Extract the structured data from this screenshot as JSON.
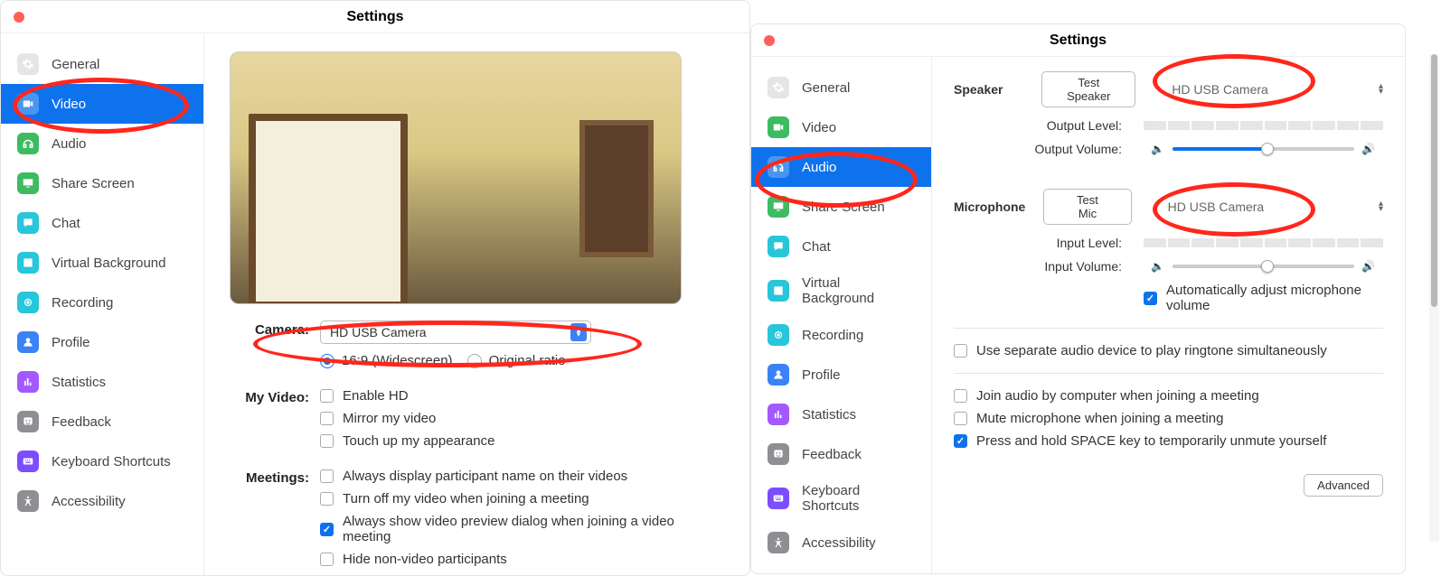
{
  "annotation_color": "#ff261b",
  "left": {
    "title": "Settings",
    "sidebar": [
      {
        "label": "General",
        "name": "general",
        "iconBg": "#e5e5e5"
      },
      {
        "label": "Video",
        "name": "video",
        "iconBg": "#0e72ed",
        "selected": true
      },
      {
        "label": "Audio",
        "name": "audio",
        "iconBg": "#3dbb61"
      },
      {
        "label": "Share Screen",
        "name": "share-screen",
        "iconBg": "#3dbb61"
      },
      {
        "label": "Chat",
        "name": "chat",
        "iconBg": "#27c6da"
      },
      {
        "label": "Virtual Background",
        "name": "virtual-background",
        "iconBg": "#27c6da"
      },
      {
        "label": "Recording",
        "name": "recording",
        "iconBg": "#27c6da"
      },
      {
        "label": "Profile",
        "name": "profile",
        "iconBg": "#3b82f6"
      },
      {
        "label": "Statistics",
        "name": "statistics",
        "iconBg": "#a259ff"
      },
      {
        "label": "Feedback",
        "name": "feedback",
        "iconBg": "#8e8e93"
      },
      {
        "label": "Keyboard Shortcuts",
        "name": "keyboard-shortcuts",
        "iconBg": "#7c4dff"
      },
      {
        "label": "Accessibility",
        "name": "accessibility",
        "iconBg": "#8e8e93"
      }
    ],
    "camera_label": "Camera:",
    "camera_value": "HD USB Camera",
    "ratio": {
      "wide": "16:9 (Widescreen)",
      "orig": "Original ratio",
      "selected": "wide"
    },
    "myvideo_label": "My Video:",
    "myvideo": [
      {
        "label": "Enable HD",
        "checked": false
      },
      {
        "label": "Mirror my video",
        "checked": false
      },
      {
        "label": "Touch up my appearance",
        "checked": false
      }
    ],
    "meetings_label": "Meetings:",
    "meetings": [
      {
        "label": "Always display participant name on their videos",
        "checked": false
      },
      {
        "label": "Turn off my video when joining a meeting",
        "checked": false
      },
      {
        "label": "Always show video preview dialog when joining a video meeting",
        "checked": true
      },
      {
        "label": "Hide non-video participants",
        "checked": false
      }
    ]
  },
  "right": {
    "title": "Settings",
    "sidebar": [
      {
        "label": "General",
        "name": "general",
        "iconBg": "#e5e5e5"
      },
      {
        "label": "Video",
        "name": "video",
        "iconBg": "#3dbb61"
      },
      {
        "label": "Audio",
        "name": "audio",
        "iconBg": "#0e72ed",
        "selected": true
      },
      {
        "label": "Share Screen",
        "name": "share-screen",
        "iconBg": "#3dbb61"
      },
      {
        "label": "Chat",
        "name": "chat",
        "iconBg": "#27c6da"
      },
      {
        "label": "Virtual Background",
        "name": "virtual-background",
        "iconBg": "#27c6da"
      },
      {
        "label": "Recording",
        "name": "recording",
        "iconBg": "#27c6da"
      },
      {
        "label": "Profile",
        "name": "profile",
        "iconBg": "#3b82f6"
      },
      {
        "label": "Statistics",
        "name": "statistics",
        "iconBg": "#a259ff"
      },
      {
        "label": "Feedback",
        "name": "feedback",
        "iconBg": "#8e8e93"
      },
      {
        "label": "Keyboard Shortcuts",
        "name": "keyboard-shortcuts",
        "iconBg": "#7c4dff"
      },
      {
        "label": "Accessibility",
        "name": "accessibility",
        "iconBg": "#8e8e93"
      }
    ],
    "speaker": {
      "label": "Speaker",
      "test": "Test Speaker",
      "device": "HD USB Camera",
      "output_level": "Output Level:",
      "output_volume": "Output Volume:",
      "volume_percent": 52
    },
    "mic": {
      "label": "Microphone",
      "test": "Test Mic",
      "device": "HD USB Camera",
      "input_level": "Input Level:",
      "input_volume": "Input Volume:",
      "volume_percent": 52,
      "auto": "Automatically adjust microphone volume",
      "auto_checked": true
    },
    "options": [
      {
        "label": "Use separate audio device to play ringtone simultaneously",
        "checked": false
      }
    ],
    "options2": [
      {
        "label": "Join audio by computer when joining a meeting",
        "checked": false
      },
      {
        "label": "Mute microphone when joining a meeting",
        "checked": false
      },
      {
        "label": "Press and hold SPACE key to temporarily unmute yourself",
        "checked": true
      }
    ],
    "advanced": "Advanced"
  }
}
